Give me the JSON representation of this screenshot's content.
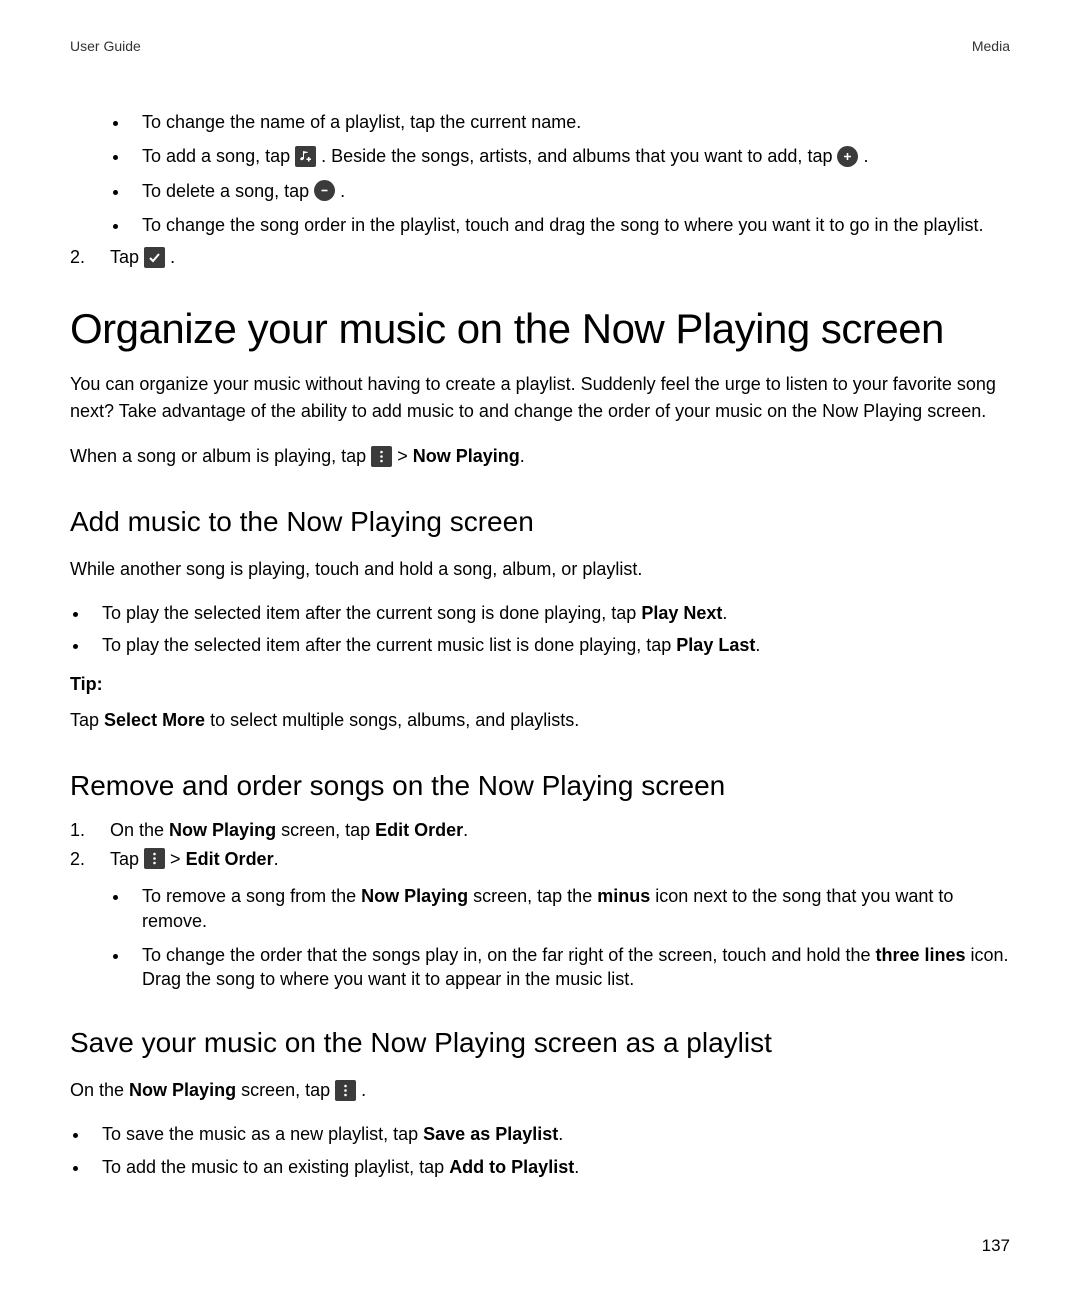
{
  "header": {
    "left": "User Guide",
    "right": "Media"
  },
  "playlist_edit": {
    "b1": "To change the name of a playlist, tap the current name.",
    "b2a": "To add a song, tap",
    "b2b": ". Beside the songs, artists, and albums that you want to add, tap",
    "b2c": ".",
    "b3a": "To delete a song, tap",
    "b3b": ".",
    "b4": "To change the song order in the playlist, touch and drag the song to where you want it to go in the playlist.",
    "step2_num": "2.",
    "step2a": "Tap",
    "step2b": "."
  },
  "h1": "Organize your music on the Now Playing screen",
  "intro": "You can organize your music without having to create a playlist. Suddenly feel the urge to listen to your favorite song next? Take advantage of the ability to add music to and change the order of your music on the Now Playing screen.",
  "when_playing_a": "When a song or album is playing, tap ",
  "when_playing_b": " > ",
  "now_playing": "Now Playing",
  "when_playing_c": ".",
  "h2_add": "Add music to the Now Playing screen",
  "add_intro": "While another song is playing, touch and hold a song, album, or playlist.",
  "add_b1a": "To play the selected item after the current song is done playing, tap ",
  "play_next": "Play Next",
  "add_b1b": ".",
  "add_b2a": "To play the selected item after the current music list is done playing, tap ",
  "play_last": "Play Last",
  "add_b2b": ".",
  "tip_label": "Tip:",
  "tip_a": "Tap ",
  "select_more": "Select More",
  "tip_b": " to select multiple songs, albums, and playlists.",
  "h2_remove": "Remove and order songs on the Now Playing screen",
  "rem_s1n": "1.",
  "rem_s1a": "On the ",
  "rem_s1b": " screen, tap ",
  "edit_order": "Edit Order",
  "rem_s1c": ".",
  "rem_s2n": "2.",
  "rem_s2a": "Tap ",
  "rem_s2b": " > ",
  "rem_s2c": ".",
  "rem_b1a": "To remove a song from the ",
  "rem_b1b": " screen, tap the ",
  "minus": "minus",
  "rem_b1c": " icon next to the song that you want to remove.",
  "rem_b2a": "To change the order that the songs play in, on the far right of the screen, touch and hold the ",
  "three_lines": "three lines",
  "rem_b2b": " icon. Drag the song to where you want it to appear in the music list.",
  "h2_save": "Save your music on the Now Playing screen as a playlist",
  "save_intro_a": "On the ",
  "save_intro_b": " screen, tap ",
  "save_intro_c": ".",
  "save_b1a": "To save the music as a new playlist, tap ",
  "save_as_playlist": "Save as Playlist",
  "save_b1b": ".",
  "save_b2a": "To add the music to an existing playlist, tap ",
  "add_to_playlist": "Add to Playlist",
  "save_b2b": ".",
  "page_num": "137"
}
